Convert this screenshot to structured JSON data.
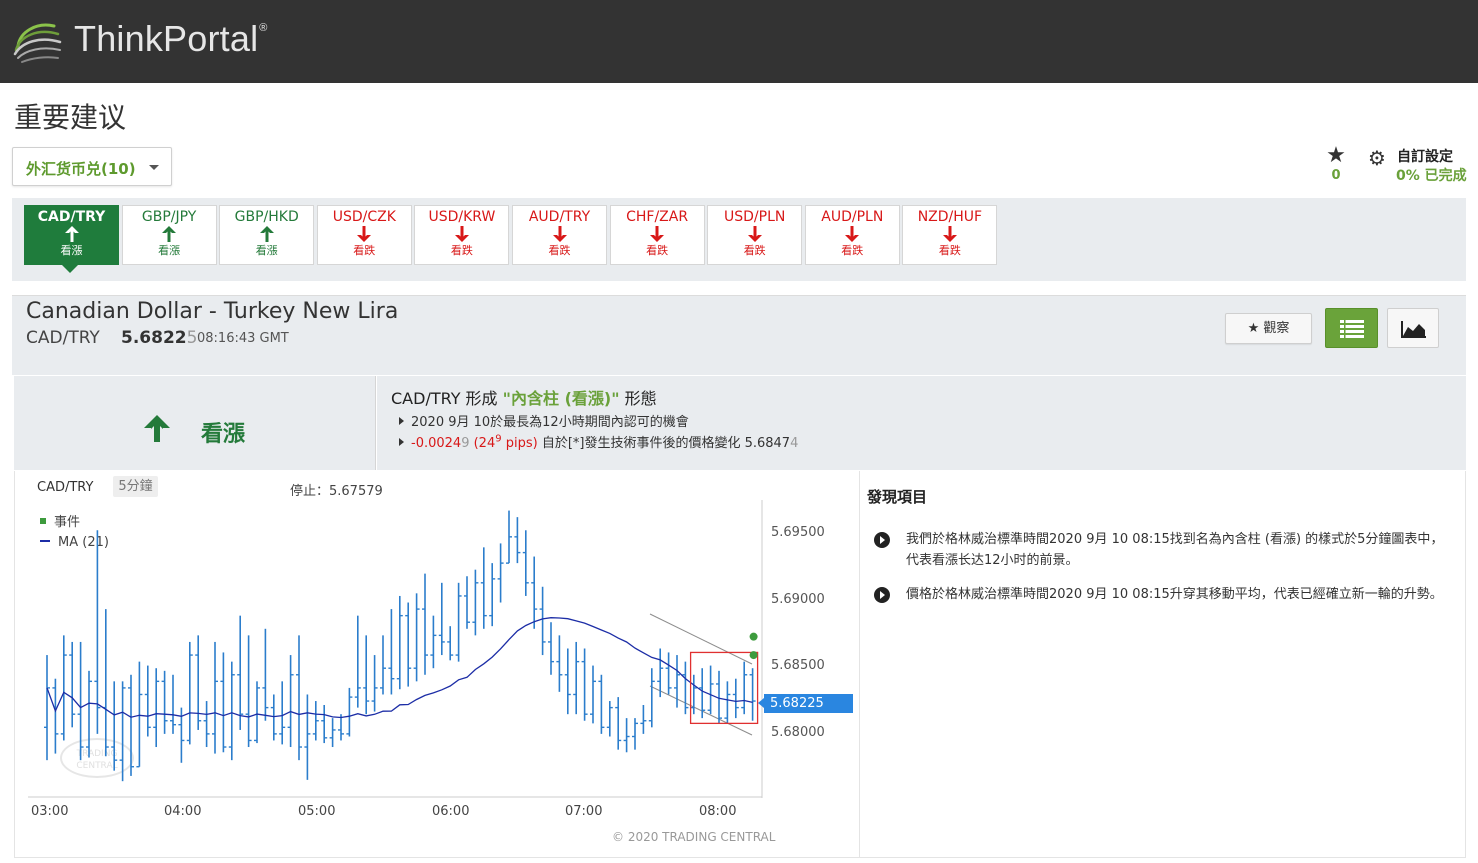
{
  "header": {
    "brand": "ThinkPortal",
    "brand_mark": "®"
  },
  "page": {
    "title": "重要建议",
    "dropdown_label": "外汇货币兑(10)"
  },
  "toolbar": {
    "star_count": "0",
    "settings_label": "自訂設定",
    "settings_progress": "0% 已完成"
  },
  "tabs": [
    {
      "pair": "CAD/TRY",
      "dir": "看漲",
      "trend": "up"
    },
    {
      "pair": "GBP/JPY",
      "dir": "看漲",
      "trend": "up"
    },
    {
      "pair": "GBP/HKD",
      "dir": "看漲",
      "trend": "up"
    },
    {
      "pair": "USD/CZK",
      "dir": "看跌",
      "trend": "down"
    },
    {
      "pair": "USD/KRW",
      "dir": "看跌",
      "trend": "down"
    },
    {
      "pair": "AUD/TRY",
      "dir": "看跌",
      "trend": "down"
    },
    {
      "pair": "CHF/ZAR",
      "dir": "看跌",
      "trend": "down"
    },
    {
      "pair": "USD/PLN",
      "dir": "看跌",
      "trend": "down"
    },
    {
      "pair": "AUD/PLN",
      "dir": "看跌",
      "trend": "down"
    },
    {
      "pair": "NZD/HUF",
      "dir": "看跌",
      "trend": "down"
    }
  ],
  "instrument": {
    "name": "Canadian Dollar - Turkey New Lira",
    "symbol": "CAD/TRY",
    "price_main": "5.6822",
    "price_last": "5",
    "time": "08:16:43 GMT",
    "watch_label": "觀察"
  },
  "signal": {
    "direction": "看漲",
    "title_prefix": "CAD/TRY 形成 ",
    "title_pattern": "\"內含柱 (看漲)\"",
    "title_suffix": " 形態",
    "bullet1": "2020 9月 10於最長為12小時期間內認可的機會",
    "bullet2_change": "-0.0024",
    "bullet2_change_last": "9",
    "bullet2_pips_open": " (24",
    "bullet2_pips_sup": "9",
    "bullet2_pips_close": " pips)",
    "bullet2_text": " 自於[*]發生技術事件後的價格變化 5.6847",
    "bullet2_price_last": "4"
  },
  "chart": {
    "symbol": "CAD/TRY",
    "timeframe": "5分鐘",
    "stop": "停止：5.67579",
    "legend_event": "事件",
    "legend_ma": "MA (21)",
    "price_tag": "5.68225",
    "copyright": "© 2020 TRADING CENTRAL",
    "watermark": "TRADING CENTRAL"
  },
  "chart_data": {
    "type": "ohlc",
    "x_ticks": [
      "03:00",
      "04:00",
      "05:00",
      "06:00",
      "07:00",
      "08:00"
    ],
    "y_ticks": [
      "5.69500",
      "5.69000",
      "5.68500",
      "5.68000"
    ],
    "ylim": [
      5.6755,
      5.6975
    ],
    "current_price": 5.68225,
    "stop": 5.67579,
    "series": [
      {
        "name": "MA (21)",
        "color": "#1c2da6"
      }
    ],
    "bars_color": "#2b7dcc",
    "event_color": "#3d9b3d",
    "bars": [
      [
        5.6805,
        5.686,
        5.678,
        5.6835
      ],
      [
        5.6835,
        5.6842,
        5.6785,
        5.68
      ],
      [
        5.68,
        5.6875,
        5.6795,
        5.686
      ],
      [
        5.686,
        5.687,
        5.6805,
        5.6815
      ],
      [
        5.6815,
        5.687,
        5.678,
        5.679
      ],
      [
        5.679,
        5.6848,
        5.6782,
        5.684
      ],
      [
        5.684,
        5.6955,
        5.68,
        5.682
      ],
      [
        5.682,
        5.6895,
        5.6783,
        5.679
      ],
      [
        5.679,
        5.684,
        5.6772,
        5.678
      ],
      [
        5.678,
        5.684,
        5.6764,
        5.6835
      ],
      [
        5.6835,
        5.6845,
        5.6768,
        5.6775
      ],
      [
        5.6775,
        5.6855,
        5.6775,
        5.683
      ],
      [
        5.683,
        5.6852,
        5.6798,
        5.6805
      ],
      [
        5.6805,
        5.685,
        5.679,
        5.684
      ],
      [
        5.684,
        5.6848,
        5.68,
        5.681
      ],
      [
        5.681,
        5.6845,
        5.68,
        5.6807
      ],
      [
        5.6807,
        5.682,
        5.6778,
        5.6795
      ],
      [
        5.6795,
        5.687,
        5.6792,
        5.686
      ],
      [
        5.686,
        5.6875,
        5.6803,
        5.681
      ],
      [
        5.681,
        5.6825,
        5.679,
        5.68
      ],
      [
        5.68,
        5.687,
        5.6785,
        5.684
      ],
      [
        5.684,
        5.6862,
        5.6786,
        5.679
      ],
      [
        5.679,
        5.6855,
        5.678,
        5.6845
      ],
      [
        5.6845,
        5.689,
        5.6803,
        5.6815
      ],
      [
        5.6815,
        5.6875,
        5.679,
        5.6795
      ],
      [
        5.6795,
        5.684,
        5.6793,
        5.6835
      ],
      [
        5.6835,
        5.688,
        5.681,
        5.682
      ],
      [
        5.682,
        5.683,
        5.6795,
        5.68
      ],
      [
        5.68,
        5.684,
        5.6792,
        5.6805
      ],
      [
        5.6805,
        5.686,
        5.679,
        5.6845
      ],
      [
        5.6845,
        5.6875,
        5.678,
        5.679
      ],
      [
        5.679,
        5.683,
        5.6765,
        5.68
      ],
      [
        5.68,
        5.6825,
        5.6795,
        5.681
      ],
      [
        5.681,
        5.6822,
        5.6793,
        5.6797
      ],
      [
        5.6797,
        5.6812,
        5.679,
        5.6803
      ],
      [
        5.6803,
        5.6815,
        5.6795,
        5.68
      ],
      [
        5.68,
        5.6835,
        5.6798,
        5.6828
      ],
      [
        5.6828,
        5.689,
        5.682,
        5.6835
      ],
      [
        5.6835,
        5.6875,
        5.6815,
        5.6825
      ],
      [
        5.6825,
        5.686,
        5.6817,
        5.6835
      ],
      [
        5.6835,
        5.6875,
        5.683,
        5.685
      ],
      [
        5.685,
        5.6895,
        5.683,
        5.6842
      ],
      [
        5.6842,
        5.6905,
        5.6834,
        5.689
      ],
      [
        5.689,
        5.69,
        5.6836,
        5.685
      ],
      [
        5.685,
        5.6907,
        5.684,
        5.6895
      ],
      [
        5.6895,
        5.6922,
        5.6845,
        5.686
      ],
      [
        5.686,
        5.689,
        5.685,
        5.6875
      ],
      [
        5.6875,
        5.6915,
        5.686,
        5.687
      ],
      [
        5.687,
        5.6882,
        5.6856,
        5.686
      ],
      [
        5.686,
        5.6915,
        5.6855,
        5.6905
      ],
      [
        5.6905,
        5.692,
        5.688,
        5.6885
      ],
      [
        5.6885,
        5.6925,
        5.6875,
        5.6915
      ],
      [
        5.6915,
        5.6942,
        5.688,
        5.689
      ],
      [
        5.689,
        5.693,
        5.6882,
        5.6918
      ],
      [
        5.6918,
        5.6945,
        5.69,
        5.693
      ],
      [
        5.693,
        5.697,
        5.693,
        5.695
      ],
      [
        5.695,
        5.6965,
        5.693,
        5.6938
      ],
      [
        5.6938,
        5.6955,
        5.6905,
        5.6915
      ],
      [
        5.6915,
        5.6935,
        5.688,
        5.6895
      ],
      [
        5.6895,
        5.6912,
        5.686,
        5.687
      ],
      [
        5.687,
        5.6885,
        5.6845,
        5.6855
      ],
      [
        5.6855,
        5.6875,
        5.6832,
        5.6845
      ],
      [
        5.6845,
        5.6865,
        5.6815,
        5.683
      ],
      [
        5.683,
        5.687,
        5.6815,
        5.6855
      ],
      [
        5.6855,
        5.6865,
        5.681,
        5.6815
      ],
      [
        5.6815,
        5.6852,
        5.6808,
        5.684
      ],
      [
        5.684,
        5.6845,
        5.68,
        5.6805
      ],
      [
        5.6805,
        5.6825,
        5.6798,
        5.682
      ],
      [
        5.682,
        5.6828,
        5.6788,
        5.6795
      ],
      [
        5.6795,
        5.6812,
        5.6786,
        5.6798
      ],
      [
        5.6798,
        5.6812,
        5.6788,
        5.6808
      ],
      [
        5.6808,
        5.6822,
        5.68,
        5.681
      ],
      [
        5.681,
        5.685,
        5.6805,
        5.684
      ],
      [
        5.684,
        5.6865,
        5.6828,
        5.685
      ],
      [
        5.685,
        5.6862,
        5.683,
        5.6835
      ],
      [
        5.6835,
        5.686,
        5.682,
        5.6845
      ],
      [
        5.6845,
        5.6855,
        5.6815,
        5.682
      ],
      [
        5.682,
        5.6845,
        5.6815,
        5.6835
      ],
      [
        5.6835,
        5.685,
        5.6812,
        5.6818
      ],
      [
        5.6818,
        5.6852,
        5.6815,
        5.6838
      ],
      [
        5.6838,
        5.6848,
        5.6808,
        5.6812
      ],
      [
        5.6812,
        5.684,
        5.6808,
        5.683
      ],
      [
        5.683,
        5.6842,
        5.6812,
        5.682
      ],
      [
        5.682,
        5.6855,
        5.6815,
        5.6845
      ],
      [
        5.6845,
        5.685,
        5.681,
        5.6825
      ]
    ],
    "events": [
      5.6874,
      5.686
    ]
  },
  "findings": {
    "title": "發現項目",
    "items": [
      "我們於格林威治標準時間2020 9月 10 08:15找到名為內含柱 (看漲) 的樣式於5分鐘圖表中，代表看漲长达12小时的前景。",
      "價格於格林威治標準時間2020 9月 10 08:15升穿其移動平均，代表已經確立新一輪的升勢。"
    ]
  },
  "icons": {
    "logo": "swirl-logo-icon",
    "star": "star-icon",
    "gear": "gear-icon",
    "list": "list-icon",
    "area_chart": "area-chart-icon",
    "up_arrow": "up-arrow-icon",
    "down_arrow": "down-arrow-icon"
  },
  "colors": {
    "bullish": "#247a3a",
    "bearish": "#d81818",
    "accent_green": "#6aa13a",
    "active_tab": "#1f7c3c",
    "price_tag": "#2a86e0"
  }
}
